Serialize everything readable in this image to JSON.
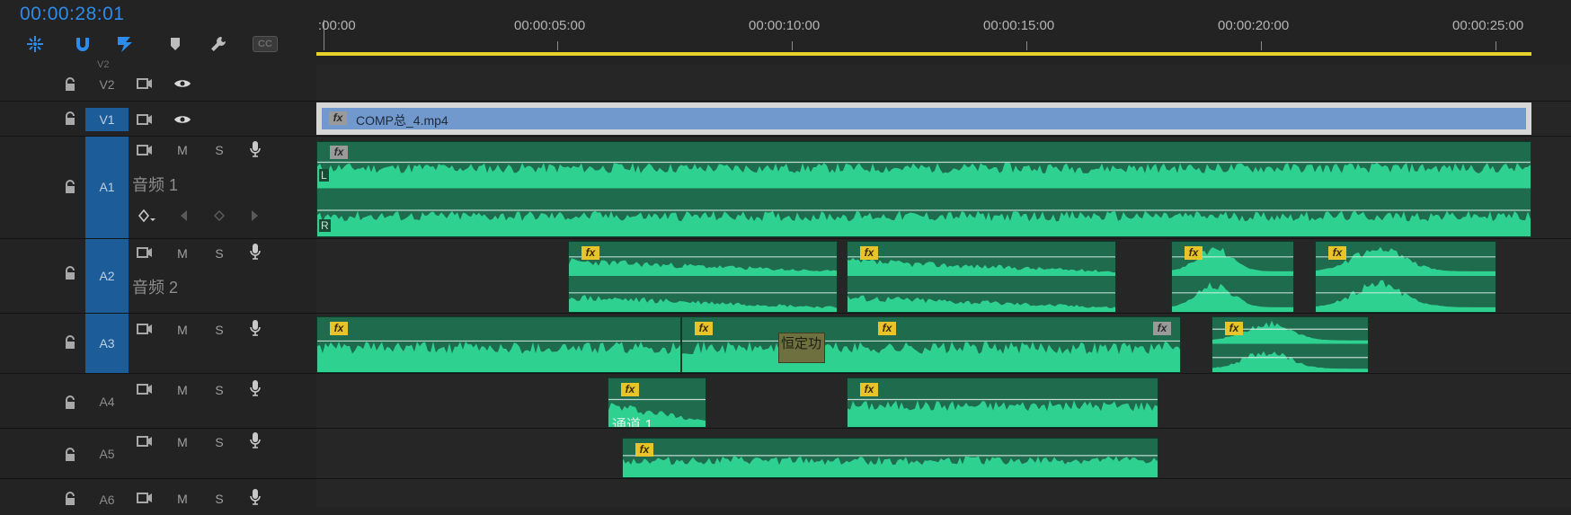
{
  "timeline": {
    "current_time": "00:00:28:01",
    "tools": [
      {
        "name": "insert-overwrite-icon"
      },
      {
        "name": "snap-magnet-icon",
        "active": true
      },
      {
        "name": "linked-selection-icon",
        "active": true
      },
      {
        "name": "add-marker-icon"
      },
      {
        "name": "wrench-settings-icon"
      },
      {
        "name": "captions-cc-icon"
      }
    ],
    "cc_label": "CC",
    "ruler": [
      ":00:00",
      "00:00:05:00",
      "00:00:10:00",
      "00:00:15:00",
      "00:00:20:00",
      "00:00:25:00"
    ],
    "accent_color": "#2d8ceb",
    "work_area_color": "#e6d22a",
    "audio_clip_color": "#1f6b4e",
    "waveform_color": "#2fd191",
    "video_clip_color": "#7299ce"
  },
  "tracks": {
    "v2": {
      "name": "V2",
      "top_hint": "V2"
    },
    "v1": {
      "name": "V1"
    },
    "a1": {
      "name": "A1",
      "label": "音频 1",
      "m": "M",
      "s": "S"
    },
    "a2": {
      "name": "A2",
      "label": "音频 2",
      "m": "M",
      "s": "S"
    },
    "a3": {
      "name": "A3",
      "m": "M",
      "s": "S"
    },
    "a4": {
      "name": "A4",
      "m": "M",
      "s": "S"
    },
    "a5": {
      "name": "A5",
      "m": "M",
      "s": "S"
    },
    "a6": {
      "name": "A6",
      "m": "M",
      "s": "S"
    }
  },
  "clips": {
    "v1_clip": {
      "name": "COMP总_4.mp4",
      "fx": "fx"
    },
    "a1_clip": {
      "fx": "fx",
      "left_channel": "L",
      "right_channel": "R"
    },
    "fx_label": "fx",
    "crossfade_label": "恒定功",
    "a4_clip_name": "通道 1"
  }
}
